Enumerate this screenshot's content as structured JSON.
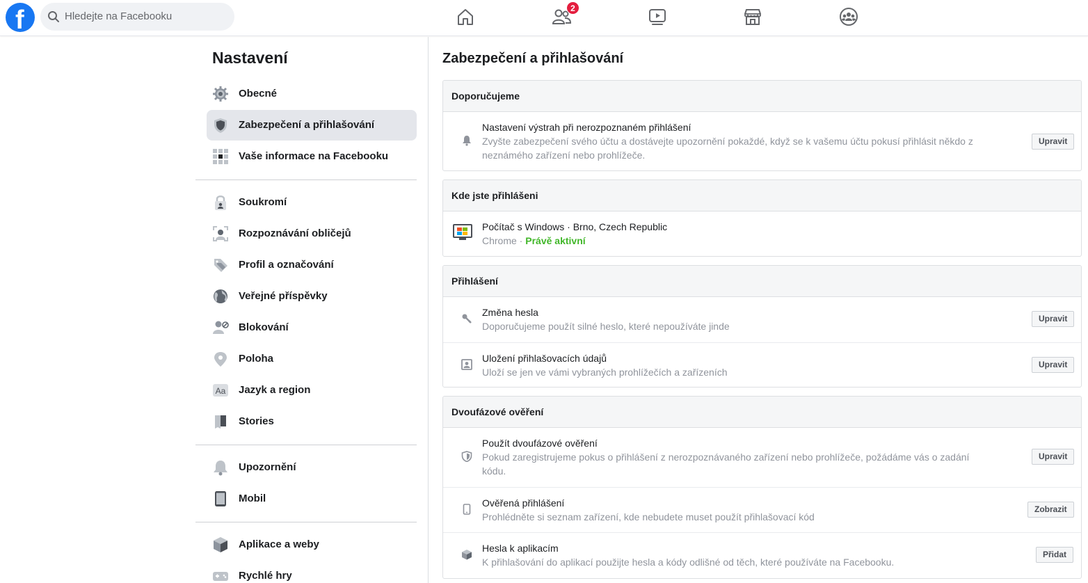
{
  "header": {
    "search_placeholder": "Hledejte na Facebooku",
    "friend_requests_badge": "2"
  },
  "sidebar": {
    "title": "Nastavení",
    "groups": [
      {
        "items": [
          {
            "label": "Obecné",
            "icon": "gear-icon"
          },
          {
            "label": "Zabezpečení a přihlašování",
            "icon": "shield-icon",
            "active": true
          },
          {
            "label": "Vaše informace na Facebooku",
            "icon": "grid-icon"
          }
        ]
      },
      {
        "items": [
          {
            "label": "Soukromí",
            "icon": "lock-icon"
          },
          {
            "label": "Rozpoznávání obličejů",
            "icon": "face-icon"
          },
          {
            "label": "Profil a označování",
            "icon": "tag-icon"
          },
          {
            "label": "Veřejné příspěvky",
            "icon": "globe-icon"
          },
          {
            "label": "Blokování",
            "icon": "block-user-icon"
          },
          {
            "label": "Poloha",
            "icon": "location-pin-icon"
          },
          {
            "label": "Jazyk a region",
            "icon": "language-icon"
          },
          {
            "label": "Stories",
            "icon": "book-icon"
          }
        ]
      },
      {
        "items": [
          {
            "label": "Upozornění",
            "icon": "bell-icon"
          },
          {
            "label": "Mobil",
            "icon": "phone-icon"
          }
        ]
      },
      {
        "items": [
          {
            "label": "Aplikace a weby",
            "icon": "cube-icon"
          },
          {
            "label": "Rychlé hry",
            "icon": "gamepad-icon"
          }
        ]
      }
    ]
  },
  "main": {
    "title": "Zabezpečení a přihlašování",
    "recommended": {
      "header": "Doporučujeme",
      "row": {
        "title": "Nastavení výstrah při nerozpoznaném přihlášení",
        "desc_line1": "Zvyšte zabezpečení svého účtu a dostávejte upozornění pokaždé, když se k vašemu účtu pokusí přihlásit někdo z",
        "desc_line2": "neznámého zařízení nebo prohlížeče.",
        "button": "Upravit"
      }
    },
    "where_logged_in": {
      "header": "Kde jste přihlášeni",
      "device": "Počítač s Windows · Brno, Czech Republic",
      "browser": "Chrome",
      "separator": " · ",
      "status": "Právě aktivní"
    },
    "login": {
      "header": "Přihlášení",
      "rows": [
        {
          "title": "Změna hesla",
          "desc": "Doporučujeme použít silné heslo, které nepoužíváte jinde",
          "button": "Upravit"
        },
        {
          "title": "Uložení přihlašovacích údajů",
          "desc": "Uloží se jen ve vámi vybraných prohlížečích a zařízeních",
          "button": "Upravit"
        }
      ]
    },
    "two_factor": {
      "header": "Dvoufázové ověření",
      "rows": [
        {
          "title": "Použít dvoufázové ověření",
          "desc_line1": "Pokud zaregistrujeme pokus o přihlášení z nerozpoznávaného zařízení nebo prohlížeče, požádáme vás o zadání",
          "desc_line2": "kódu.",
          "button": "Upravit"
        },
        {
          "title": "Ověřená přihlášení",
          "desc": "Prohlédněte si seznam zařízení, kde nebudete muset použít přihlašovací kód",
          "button": "Zobrazit"
        },
        {
          "title": "Hesla k aplikacím",
          "desc": "K přihlašování do aplikací použijte hesla a kódy odlišné od těch, které používáte na Facebooku.",
          "button": "Přidat"
        }
      ]
    }
  },
  "colors": {
    "brand": "#1877f2",
    "active": "#42b72a",
    "badge": "#e41e3f"
  }
}
